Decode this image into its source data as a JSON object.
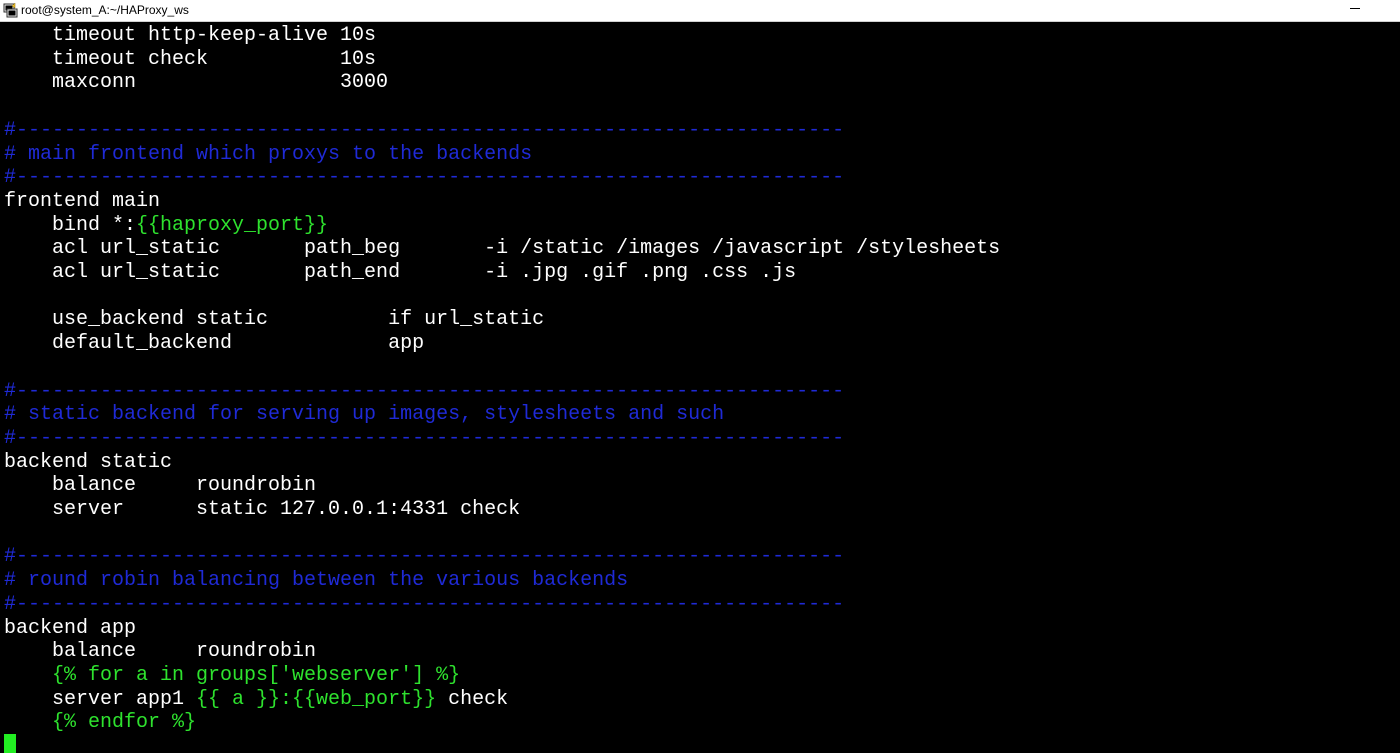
{
  "window": {
    "title": "root@system_A:~/HAProxy_ws",
    "icon": "putty-icon",
    "minimize_icon": "minimize-icon"
  },
  "terminal": {
    "colors": {
      "background": "#000000",
      "text": "#ffffff",
      "comment": "#1f2ad6",
      "template": "#2ee22e",
      "cursor": "#22ee22"
    },
    "lines": [
      [
        {
          "t": "    timeout http-keep-alive 10s",
          "c": "normal"
        }
      ],
      [
        {
          "t": "    timeout check           10s",
          "c": "normal"
        }
      ],
      [
        {
          "t": "    maxconn                 3000",
          "c": "normal"
        }
      ],
      [
        {
          "t": "",
          "c": "normal"
        }
      ],
      [
        {
          "t": "#---------------------------------------------------------------------",
          "c": "blue"
        }
      ],
      [
        {
          "t": "# main frontend which proxys to the backends",
          "c": "blue"
        }
      ],
      [
        {
          "t": "#---------------------------------------------------------------------",
          "c": "blue"
        }
      ],
      [
        {
          "t": "frontend main",
          "c": "normal"
        }
      ],
      [
        {
          "t": "    bind *:",
          "c": "normal"
        },
        {
          "t": "{{haproxy_port}}",
          "c": "green"
        }
      ],
      [
        {
          "t": "    acl url_static       path_beg       -i /static /images /javascript /stylesheets",
          "c": "normal"
        }
      ],
      [
        {
          "t": "    acl url_static       path_end       -i .jpg .gif .png .css .js",
          "c": "normal"
        }
      ],
      [
        {
          "t": "",
          "c": "normal"
        }
      ],
      [
        {
          "t": "    use_backend static          if url_static",
          "c": "normal"
        }
      ],
      [
        {
          "t": "    default_backend             app",
          "c": "normal"
        }
      ],
      [
        {
          "t": "",
          "c": "normal"
        }
      ],
      [
        {
          "t": "#---------------------------------------------------------------------",
          "c": "blue"
        }
      ],
      [
        {
          "t": "# static backend for serving up images, stylesheets and such",
          "c": "blue"
        }
      ],
      [
        {
          "t": "#---------------------------------------------------------------------",
          "c": "blue"
        }
      ],
      [
        {
          "t": "backend static",
          "c": "normal"
        }
      ],
      [
        {
          "t": "    balance     roundrobin",
          "c": "normal"
        }
      ],
      [
        {
          "t": "    server      static 127.0.0.1:4331 check",
          "c": "normal"
        }
      ],
      [
        {
          "t": "",
          "c": "normal"
        }
      ],
      [
        {
          "t": "#---------------------------------------------------------------------",
          "c": "blue"
        }
      ],
      [
        {
          "t": "# round robin balancing between the various backends",
          "c": "blue"
        }
      ],
      [
        {
          "t": "#---------------------------------------------------------------------",
          "c": "blue"
        }
      ],
      [
        {
          "t": "backend app",
          "c": "normal"
        }
      ],
      [
        {
          "t": "    balance     roundrobin",
          "c": "normal"
        }
      ],
      [
        {
          "t": "    {% for a in groups['webserver'] %}",
          "c": "green"
        }
      ],
      [
        {
          "t": "    server app1 ",
          "c": "normal"
        },
        {
          "t": "{{ a }}:{{web_port}}",
          "c": "green"
        },
        {
          "t": " check",
          "c": "normal"
        }
      ],
      [
        {
          "t": "    {% endfor %}",
          "c": "green"
        }
      ]
    ]
  }
}
